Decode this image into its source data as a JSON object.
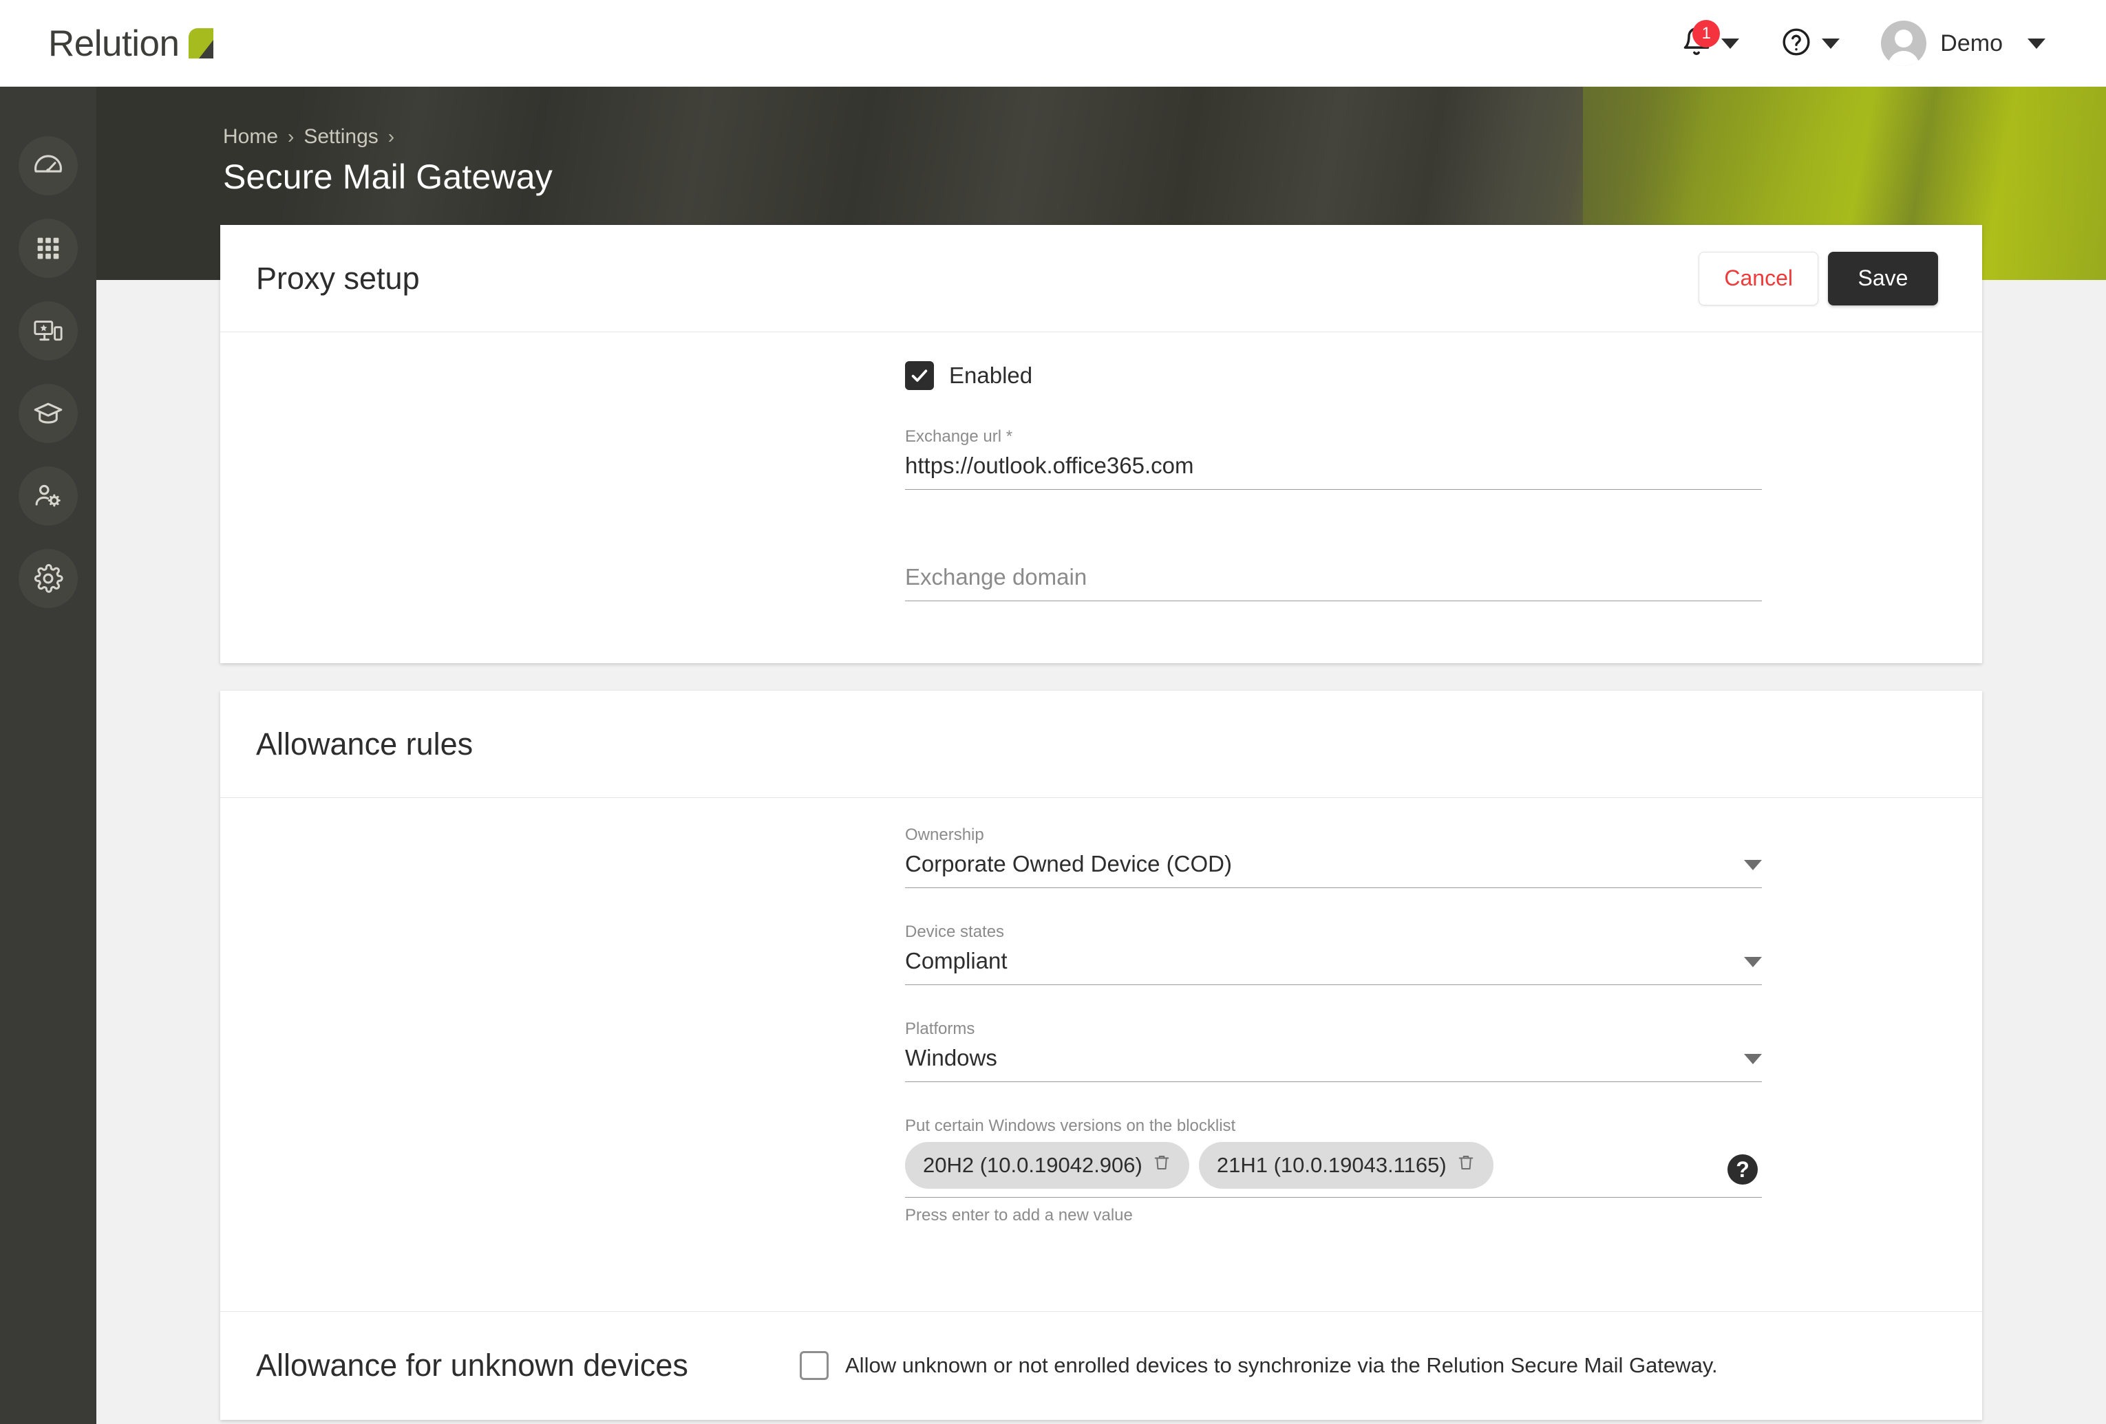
{
  "app": {
    "brand_name": "Relution",
    "brand_mark_icon": "relution-logo-mark",
    "accent_green": "#a6bb1e",
    "dark": "#3a3a36"
  },
  "topbar": {
    "notifications": {
      "icon": "bell-icon",
      "badge_count": "1",
      "chevron_icon": "chevron-down-icon"
    },
    "help": {
      "icon": "help-circle-icon",
      "chevron_icon": "chevron-down-icon"
    },
    "user": {
      "avatar_icon": "avatar-icon",
      "name": "Demo",
      "chevron_icon": "chevron-down-icon"
    }
  },
  "sidebar": {
    "items": [
      {
        "name": "dashboard",
        "icon": "speedometer-icon"
      },
      {
        "name": "apps",
        "icon": "grid-apps-icon"
      },
      {
        "name": "devices",
        "icon": "device-star-icon"
      },
      {
        "name": "education",
        "icon": "graduation-cap-icon"
      },
      {
        "name": "users",
        "icon": "user-settings-icon"
      },
      {
        "name": "settings",
        "icon": "gear-icon"
      }
    ]
  },
  "banner": {
    "breadcrumb": [
      {
        "label": "Home"
      },
      {
        "label": "Settings"
      }
    ],
    "breadcrumb_separator": "›",
    "page_title": "Secure Mail Gateway"
  },
  "proxy_setup": {
    "title": "Proxy setup",
    "cancel_label": "Cancel",
    "save_label": "Save",
    "enabled": {
      "label": "Enabled",
      "checked": true,
      "check_icon": "checkmark-icon"
    },
    "exchange_url": {
      "label": "Exchange url *",
      "value": "https://outlook.office365.com"
    },
    "exchange_domain": {
      "label": "",
      "placeholder": "Exchange domain",
      "value": ""
    }
  },
  "allowance_rules": {
    "title": "Allowance rules",
    "ownership": {
      "label": "Ownership",
      "value": "Corporate Owned Device (COD)",
      "caret_icon": "caret-down-icon"
    },
    "device_states": {
      "label": "Device states",
      "value": "Compliant",
      "caret_icon": "caret-down-icon"
    },
    "platforms": {
      "label": "Platforms",
      "value": "Windows",
      "caret_icon": "caret-down-icon"
    },
    "blocklist": {
      "label": "Put certain Windows versions on the blocklist",
      "hint": "Press enter to add a new value",
      "help_icon": "help-filled-icon",
      "help_glyph": "?",
      "chips": [
        {
          "label": "20H2 (10.0.19042.906)",
          "delete_icon": "trash-icon"
        },
        {
          "label": "21H1 (10.0.19043.1165)",
          "delete_icon": "trash-icon"
        }
      ]
    }
  },
  "allowance_unknown": {
    "title": "Allowance for unknown devices",
    "checkbox": {
      "label": "Allow unknown or not enrolled devices to synchronize via the Relution Secure Mail Gateway.",
      "checked": false
    }
  }
}
